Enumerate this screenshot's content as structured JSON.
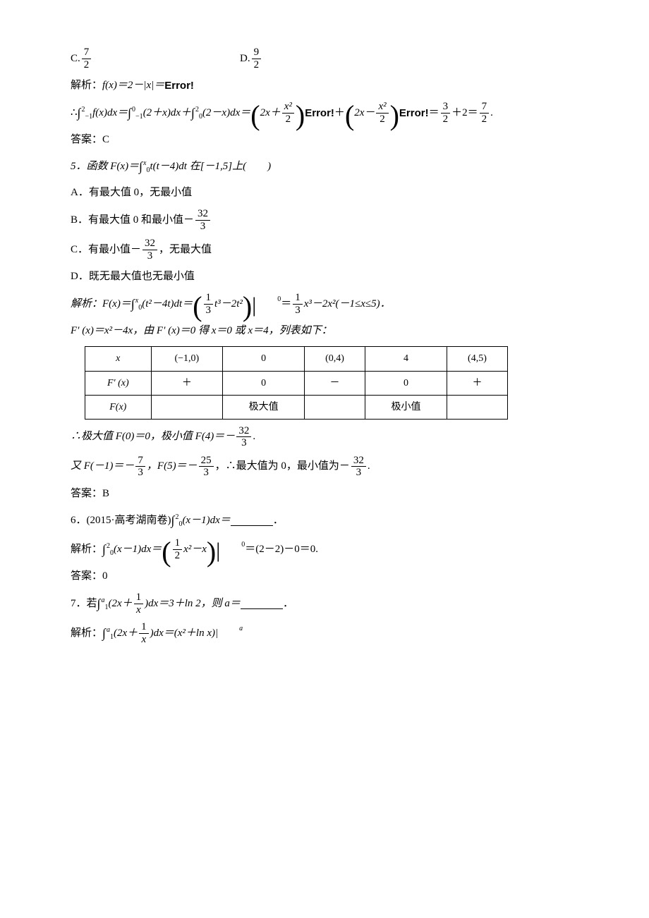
{
  "options": {
    "C": {
      "label": "C.",
      "num": "7",
      "den": "2"
    },
    "D": {
      "label": "D.",
      "num": "9",
      "den": "2"
    }
  },
  "q4": {
    "sol_prefix": "解析：",
    "sol_body_a": "f(x)＝2－|x|＝",
    "error": "Error!",
    "therefore": "∴",
    "int_lhs": "f(x)dx＝",
    "int_bounds_a": {
      "lo": "−1",
      "hi": "2"
    },
    "int_rhs1": "(2＋x)dx＋",
    "int_bounds_b": {
      "lo": "−1",
      "hi": "0"
    },
    "int_rhs2": "(2－x)dx＝",
    "int_bounds_c": {
      "lo": "0",
      "hi": "2"
    },
    "br1_a": "2x＋",
    "br1_num": "x²",
    "br1_den": "2",
    "plus": "＋",
    "br2_a": "2x－",
    "br2_num": "x²",
    "br2_den": "2",
    "eq": "＝",
    "f3n": "3",
    "f3d": "2",
    "plus2": "＋2＝",
    "f7n": "7",
    "f7d": "2",
    "dot": ".",
    "ans_label": "答案：",
    "ans": "C"
  },
  "q5": {
    "stem_a": "5．函数 F(x)＝",
    "int_bounds": {
      "lo": "0",
      "hi": "x"
    },
    "stem_b": "t(t－4)dt 在[－1,5]上(　　)",
    "A": "A．有最大值 0，无最小值",
    "B_a": "B．有最大值 0 和最小值－",
    "B_num": "32",
    "B_den": "3",
    "C_a": "C．有最小值－",
    "C_num": "32",
    "C_den": "3",
    "C_b": "，无最大值",
    "D": "D．既无最大值也无最小值",
    "sol_a": "解析：F(x)＝",
    "sol_int_bounds": {
      "lo": "0",
      "hi": "x"
    },
    "sol_b": "(t²－4t)dt＝",
    "br_num": "1",
    "br_den": "3",
    "br_after": "t³－2t²",
    "evup": "0",
    "evtext": "＝",
    "rhs_num": "1",
    "rhs_den": "3",
    "rhs_after": "x³－2x²(－1≤x≤5)．",
    "deriv": "F′  (x)＝x²－4x，由 F′  (x)＝0 得 x＝0 或 x＝4，列表如下：",
    "table": {
      "h": [
        "x",
        "(−1,0)",
        "0",
        "(0,4)",
        "4",
        "(4,5)"
      ],
      "r1": [
        "F′  (x)",
        "＋",
        "0",
        "－",
        "0",
        "＋"
      ],
      "r2": [
        "F(x)",
        "",
        "极大值",
        "",
        "极小值",
        ""
      ]
    },
    "post_a": "∴极大值 F(0)＝0，极小值 F(4)＝－",
    "post_num": "32",
    "post_den": "3",
    "post_dot": ".",
    "post_b1": "又 F(－1)＝－",
    "fb1n": "7",
    "fb1d": "3",
    "post_b2": "，F(5)＝－",
    "fb2n": "25",
    "fb2d": "3",
    "post_b3": "，∴最大值为 0，最小值为－",
    "fb3n": "32",
    "fb3d": "3",
    "post_b4": ".",
    "ans_label": "答案：",
    "ans": "B"
  },
  "q6": {
    "stem_a": "6．(2015·高考湖南卷)",
    "int_bounds": {
      "lo": "0",
      "hi": "2"
    },
    "stem_b": "(x－1)dx＝",
    "stem_c": "．",
    "sol_a": "解析：",
    "sol_int_bounds": {
      "lo": "0",
      "hi": "2"
    },
    "sol_b": "(x－1)dx＝",
    "br_num": "1",
    "br_den": "2",
    "br_after": "x²－x",
    "evup": "0",
    "sol_c": "＝(2－2)－0＝0.",
    "ans_label": "答案：",
    "ans": "0"
  },
  "q7": {
    "stem_a": "7．若",
    "int_bounds": {
      "lo": "1",
      "hi": "a"
    },
    "stem_b": "(2x＋",
    "fr_num": "1",
    "fr_den": "x",
    "stem_c": ")dx＝3＋ln 2，则 a＝",
    "stem_d": "．",
    "sol_a": "解析：",
    "sol_int_bounds": {
      "lo": "1",
      "hi": "a"
    },
    "sol_b": "(2x＋",
    "sfr_num": "1",
    "sfr_den": "x",
    "sol_c": ")dx＝(x²＋ln x)|",
    "evup": "a"
  }
}
